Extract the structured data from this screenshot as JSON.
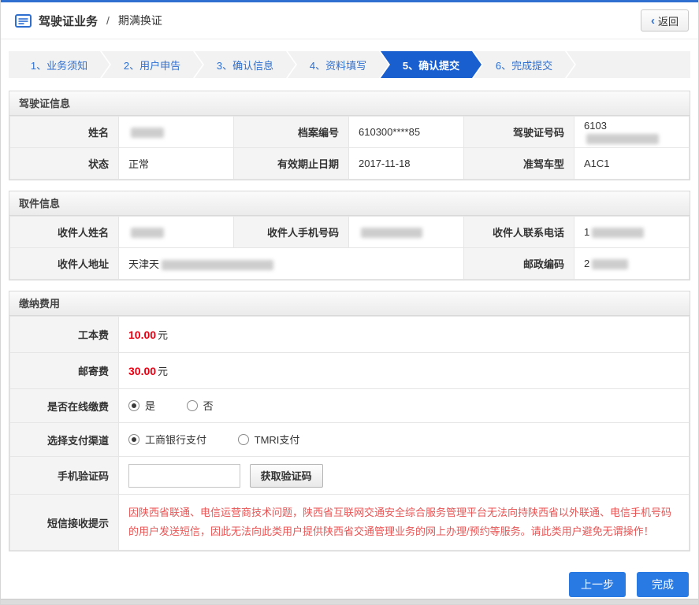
{
  "header": {
    "title": "驾驶证业务",
    "separator": "/",
    "subtitle": "期满换证",
    "back_icon": "‹",
    "back_label": "返回"
  },
  "steps": [
    {
      "label": "1、业务须知",
      "active": false
    },
    {
      "label": "2、用户申告",
      "active": false
    },
    {
      "label": "3、确认信息",
      "active": false
    },
    {
      "label": "4、资料填写",
      "active": false
    },
    {
      "label": "5、确认提交",
      "active": true
    },
    {
      "label": "6、完成提交",
      "active": false
    }
  ],
  "license": {
    "title": "驾驶证信息",
    "name_label": "姓名",
    "file_no_label": "档案编号",
    "file_no_value": "610300****85",
    "license_no_label": "驾驶证号码",
    "license_no_prefix": "6103",
    "status_label": "状态",
    "status_value": "正常",
    "valid_until_label": "有效期止日期",
    "valid_until_value": "2017-11-18",
    "vehicle_class_label": "准驾车型",
    "vehicle_class_value": "A1C1"
  },
  "pickup": {
    "title": "取件信息",
    "recipient_name_label": "收件人姓名",
    "recipient_mobile_label": "收件人手机号码",
    "recipient_phone_label": "收件人联系电话",
    "recipient_phone_prefix": "1",
    "address_label": "收件人地址",
    "address_prefix": "天津天",
    "postal_label": "邮政编码",
    "postal_prefix": "2"
  },
  "fees": {
    "title": "缴纳费用",
    "production_fee_label": "工本费",
    "production_fee_amount": "10.00",
    "production_fee_unit": "元",
    "postage_fee_label": "邮寄费",
    "postage_fee_amount": "30.00",
    "postage_fee_unit": "元",
    "online_pay_label": "是否在线缴费",
    "online_pay_options": [
      {
        "label": "是",
        "checked": true
      },
      {
        "label": "否",
        "checked": false
      }
    ],
    "channel_label": "选择支付渠道",
    "channel_options": [
      {
        "label": "工商银行支付",
        "checked": true
      },
      {
        "label": "TMRI支付",
        "checked": false
      }
    ],
    "sms_code_label": "手机验证码",
    "sms_code_value": "",
    "get_code_button": "获取验证码",
    "notice_label": "短信接收提示",
    "notice_text": "因陕西省联通、电信运营商技术问题，陕西省互联网交通安全综合服务管理平台无法向持陕西省以外联通、电信手机号码的用户发送短信，因此无法向此类用户提供陕西省交通管理业务的网上办理/预约等服务。请此类用户避免无谓操作！"
  },
  "footer": {
    "prev_label": "上一步",
    "finish_label": "完成"
  },
  "colors": {
    "accent_blue": "#2e6fd0",
    "active_step_blue": "#1a5fd0",
    "button_blue": "#2a7ae4",
    "fee_red": "#e60012",
    "notice_red": "#e85454"
  }
}
